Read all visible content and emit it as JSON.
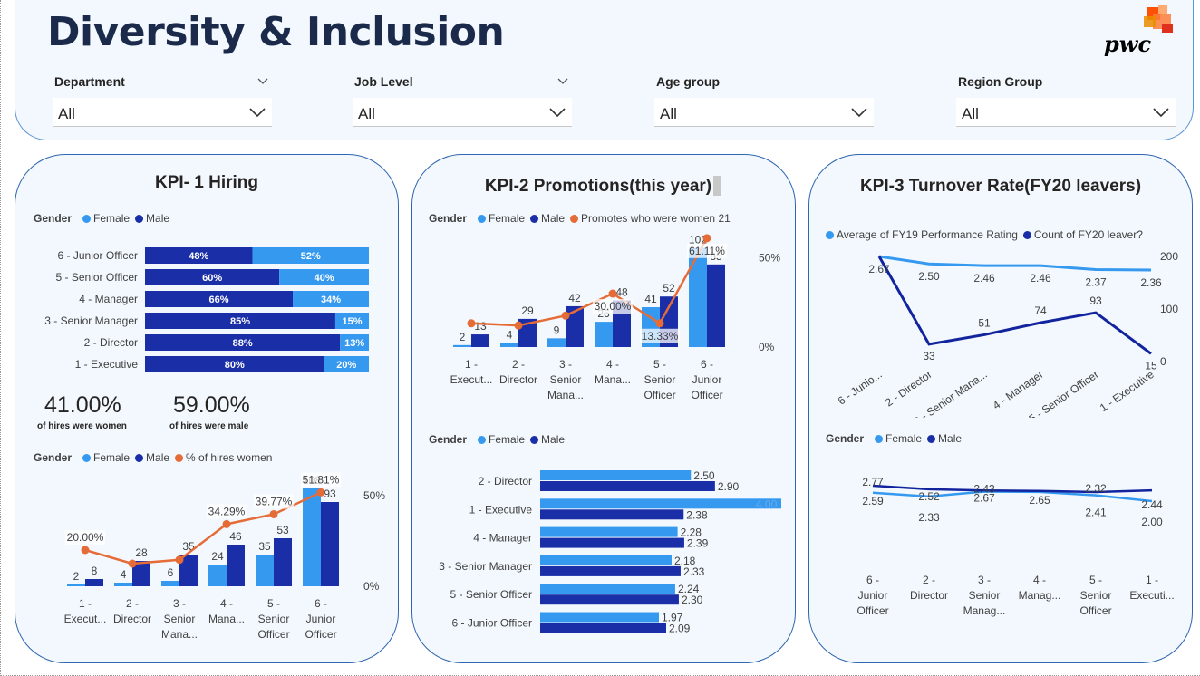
{
  "title": "Diversity & Inclusion",
  "logo": {
    "text": "pwc",
    "colors": [
      "#fd5108",
      "#fe7c39",
      "#ffaa72",
      "#e0301e",
      "#eb8c00"
    ]
  },
  "colors": {
    "female": "#3599f0",
    "male": "#1a2ea8",
    "line": "#e66c37",
    "navy_line": "#12239e",
    "light_line": "#3599f0"
  },
  "slicers": [
    {
      "label": "Department",
      "value": "All"
    },
    {
      "label": "Job Level",
      "value": "All"
    },
    {
      "label": "Age group",
      "value": "All"
    },
    {
      "label": "Region Group",
      "value": "All"
    }
  ],
  "kpi1": {
    "title": "KPI- 1 Hiring",
    "legend1": {
      "title": "Gender",
      "items": [
        "Female",
        "Male"
      ]
    },
    "stat_women": {
      "value": "41.00%",
      "caption": "of hires were women"
    },
    "stat_men": {
      "value": "59.00%",
      "caption": "of hires were male"
    },
    "legend2": {
      "title": "Gender",
      "items": [
        "Female",
        "Male",
        "% of hires women"
      ]
    }
  },
  "kpi2": {
    "title": "KPI-2 Promotions(this year)",
    "legend1": {
      "title": "Gender",
      "items": [
        "Female",
        "Male",
        "Promotes who were women 21"
      ]
    },
    "legend2": {
      "title": "Gender",
      "items": [
        "Female",
        "Male"
      ]
    }
  },
  "kpi3": {
    "title": "KPI-3 Turnover Rate(FY20 leavers)",
    "legend1": {
      "items": [
        "Average of FY19 Performance Rating",
        "Count of FY20 leaver?"
      ]
    },
    "legend2": {
      "title": "Gender",
      "items": [
        "Female",
        "Male"
      ]
    }
  },
  "chart_data": [
    {
      "id": "hiring_stacked",
      "type": "bar",
      "orientation": "horizontal-stacked-100",
      "categories": [
        "6 - Junior Officer",
        "5 - Senior Officer",
        "4 - Manager",
        "3 - Senior Manager",
        "2 - Director",
        "1 - Executive"
      ],
      "series": [
        {
          "name": "Male",
          "values": [
            48,
            60,
            66,
            85,
            88,
            80
          ],
          "labels": [
            "48%",
            "60%",
            "66%",
            "85%",
            "88%",
            "80%"
          ]
        },
        {
          "name": "Female",
          "values": [
            52,
            40,
            34,
            15,
            13,
            20
          ],
          "labels": [
            "52%",
            "40%",
            "34%",
            "15%",
            "13%",
            "20%"
          ]
        }
      ]
    },
    {
      "id": "hiring_combo",
      "type": "bar",
      "categories": [
        [
          "1 -",
          "Execut..."
        ],
        [
          "2 -",
          "Director"
        ],
        [
          "3 -",
          "Senior",
          "Mana..."
        ],
        [
          "4 -",
          "Mana..."
        ],
        [
          "5 -",
          "Senior",
          "Officer"
        ],
        [
          "6 -",
          "Junior",
          "Officer"
        ]
      ],
      "series": [
        {
          "name": "Female",
          "values": [
            2,
            4,
            6,
            24,
            35,
            108
          ],
          "labels": [
            "2",
            "4",
            "6",
            "24",
            "35",
            "108"
          ]
        },
        {
          "name": "Male",
          "values": [
            8,
            28,
            35,
            46,
            53,
            93
          ],
          "labels": [
            "8",
            "28",
            "35",
            "46",
            "53",
            "93"
          ]
        },
        {
          "name": "% of hires women",
          "values": [
            20.0,
            12.5,
            14.63,
            34.29,
            39.77,
            51.81
          ],
          "labels": [
            "20.00%",
            "",
            "",
            "34.29%",
            "39.77%",
            "51.81%"
          ]
        }
      ],
      "yticks": [
        "50%",
        "0%"
      ],
      "ylim": [
        0,
        120
      ],
      "y2lim": [
        0,
        60
      ]
    },
    {
      "id": "promotions_combo",
      "type": "bar",
      "categories": [
        [
          "1 -",
          "Execut..."
        ],
        [
          "2 -",
          "Director"
        ],
        [
          "3 -",
          "Senior",
          "Mana..."
        ],
        [
          "4 -",
          "Mana..."
        ],
        [
          "5 -",
          "Senior",
          "Officer"
        ],
        [
          "6 -",
          "Junior",
          "Officer"
        ]
      ],
      "series": [
        {
          "name": "Female",
          "values": [
            2,
            4,
            9,
            26,
            41,
            102
          ],
          "labels": [
            "2",
            "4",
            "9",
            "26",
            "41",
            "102"
          ]
        },
        {
          "name": "Male",
          "values": [
            13,
            29,
            42,
            48,
            52,
            85
          ],
          "labels": [
            "13",
            "29",
            "42",
            "48",
            "52",
            "85"
          ]
        },
        {
          "name": "Promotes who were women 21",
          "values": [
            13.33,
            12.12,
            17.65,
            30.0,
            13.33,
            61.11
          ],
          "labels": [
            "",
            "",
            "",
            "30.00%",
            "13.33%",
            "61.11%"
          ]
        }
      ],
      "yticks": [
        "50%",
        "0%"
      ],
      "ylim": [
        0,
        110
      ],
      "y2lim": [
        0,
        60
      ]
    },
    {
      "id": "promotions_rating",
      "type": "bar",
      "orientation": "horizontal",
      "categories": [
        "2 - Director",
        "1 - Executive",
        "4 - Manager",
        "3 - Senior Manager",
        "5 - Senior Officer",
        "6 - Junior Officer"
      ],
      "series": [
        {
          "name": "Female",
          "values": [
            2.5,
            4.0,
            2.28,
            2.18,
            2.24,
            1.97
          ],
          "labels": [
            "2.50",
            "4.00",
            "2.28",
            "2.18",
            "2.24",
            "1.97"
          ]
        },
        {
          "name": "Male",
          "values": [
            2.9,
            2.38,
            2.39,
            2.33,
            2.3,
            2.09
          ],
          "labels": [
            "2.90",
            "2.38",
            "2.39",
            "2.33",
            "2.30",
            "2.09"
          ]
        }
      ],
      "xlim": [
        0,
        4.0
      ]
    },
    {
      "id": "turnover_dual",
      "type": "line",
      "categories": [
        "6 - Junio...",
        "2 - Director",
        "3 - Senior Mana...",
        "4 - Manager",
        "5 - Senior Officer",
        "1 - Executive"
      ],
      "series": [
        {
          "name": "Average of FY19 Performance Rating",
          "values": [
            2.67,
            2.5,
            2.46,
            2.46,
            2.37,
            2.36
          ],
          "labels": [
            "2.67",
            "2.50",
            "2.46",
            "2.46",
            "2.37",
            "2.36"
          ]
        },
        {
          "name": "Count of FY20 leaver?",
          "values": [
            200,
            33,
            51,
            74,
            93,
            15
          ],
          "labels": [
            "",
            "33",
            "51",
            "74",
            "93",
            "15"
          ]
        }
      ],
      "yticks": [
        "200",
        "100",
        "0"
      ],
      "ylim": [
        0,
        200
      ]
    },
    {
      "id": "turnover_gender",
      "type": "line",
      "categories": [
        [
          "6 -",
          "Junior",
          "Officer"
        ],
        [
          "2 -",
          "Director"
        ],
        [
          "3 -",
          "Senior",
          "Manag..."
        ],
        [
          "4 -",
          "Manag..."
        ],
        [
          "5 -",
          "Senior",
          "Officer"
        ],
        [
          "1 -",
          "Executi..."
        ]
      ],
      "series": [
        {
          "name": "Female",
          "values": [
            2.59,
            2.33,
            2.67,
            2.65,
            2.41,
            2.0
          ],
          "labels": [
            "2.59",
            "2.33",
            "2.67",
            "2.65",
            "2.41",
            "2.00"
          ]
        },
        {
          "name": "Male",
          "values": [
            2.77,
            2.52,
            2.43,
            2.4,
            2.32,
            2.44
          ],
          "labels": [
            "2.77",
            "2.52",
            "2.43",
            "",
            "2.32",
            "2.44"
          ]
        }
      ]
    }
  ]
}
